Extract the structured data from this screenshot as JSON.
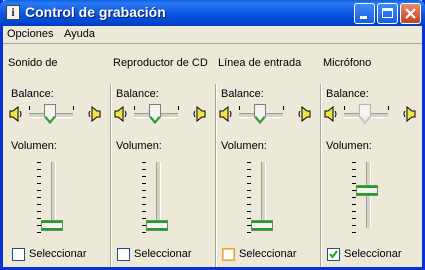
{
  "window": {
    "title": "Control de grabación"
  },
  "menu": [
    "Opciones",
    "Ayuda"
  ],
  "balance_label": "Balance:",
  "volume_label": "Volumen:",
  "select_label": "Seleccionar",
  "channels": [
    {
      "name": "Sonido de",
      "balance": 0.5,
      "volume": 0.0,
      "selected": false,
      "enabled": true
    },
    {
      "name": "Reproductor de CD",
      "balance": 0.5,
      "volume": 0.0,
      "selected": false,
      "enabled": true
    },
    {
      "name": "Línea de entrada",
      "balance": 0.5,
      "volume": 0.0,
      "selected": false,
      "enabled": true,
      "focused": true
    },
    {
      "name": "Micrófono",
      "balance": 0.5,
      "volume": 0.6,
      "selected": true,
      "enabled": true,
      "balance_disabled": true
    }
  ]
}
